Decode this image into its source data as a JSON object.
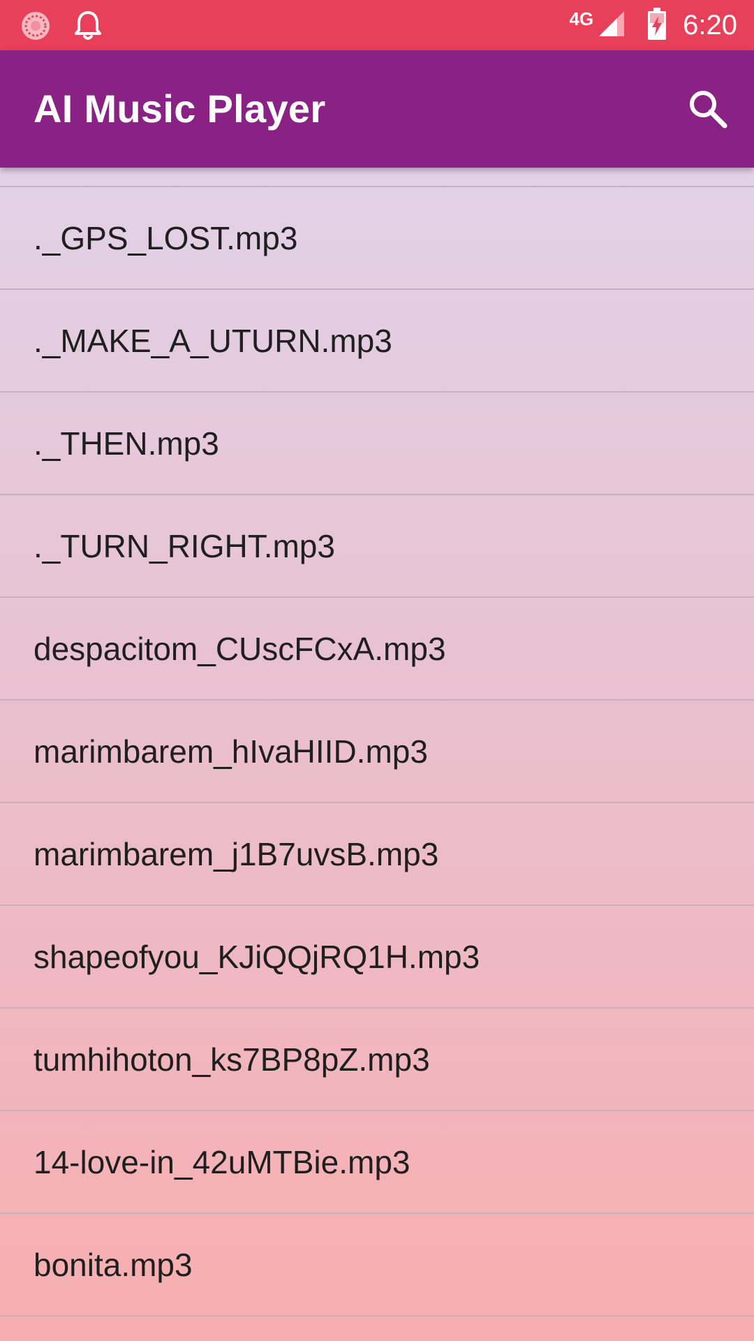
{
  "status_bar": {
    "network": "4G",
    "time": "6:20",
    "icons": [
      "sync-circle-icon",
      "notification-bell-icon",
      "signal-icon",
      "battery-charging-icon"
    ]
  },
  "app_bar": {
    "title": "AI Music Player",
    "search_icon": "search-icon"
  },
  "songs": [
    "._GPS_LOST.mp3",
    "._MAKE_A_UTURN.mp3",
    "._THEN.mp3",
    "._TURN_RIGHT.mp3",
    "despacitom_CUscFCxA.mp3",
    "marimbarem_hIvaHIID.mp3",
    "marimbarem_j1B7uvsB.mp3",
    "shapeofyou_KJiQQjRQ1H.mp3",
    "tumhihoton_ks7BP8pZ.mp3",
    "14-love-in_42uMTBie.mp3",
    "bonita.mp3"
  ],
  "colors": {
    "status_bar": "#e8405a",
    "app_bar": "#892284",
    "list_top": "#e0d7ef",
    "list_bottom": "#f8aeae"
  }
}
